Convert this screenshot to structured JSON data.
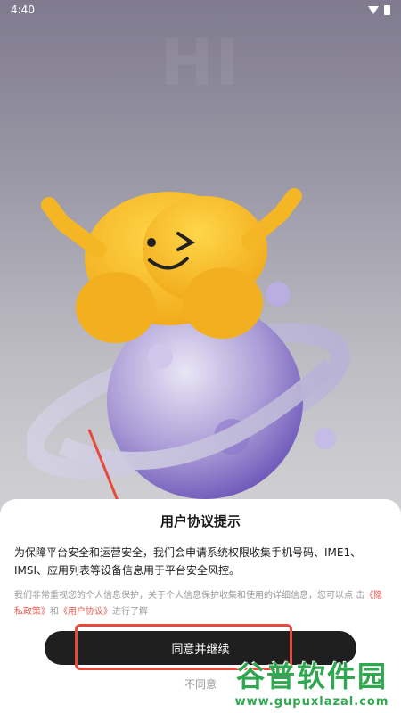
{
  "status_bar": {
    "time": "4:40"
  },
  "dialog": {
    "title": "用户协议提示",
    "body": "为保障平台安全和运营安全，我们会申请系统权限收集手机号码、IME1、IMSI、应用列表等设备信息用于平台安全风控。",
    "note_prefix": "我们非常重视您的个人信息保护，关于个人信息保护收集和使用的详细信息，您可以点 击",
    "privacy_link": "《隐私政策》",
    "note_and": "和",
    "user_agreement_link": "《用户协议》",
    "note_suffix": "进行了解",
    "agree_label": "同意并继续",
    "disagree_label": "不同意"
  },
  "watermark": {
    "main": "谷普软件园",
    "sub": "www.gupuxlazal.com"
  },
  "colors": {
    "accent_red": "#e8493b",
    "button_dark": "#1f1f1f",
    "link": "#e85a4f",
    "watermark_green": "#2fa84f"
  }
}
